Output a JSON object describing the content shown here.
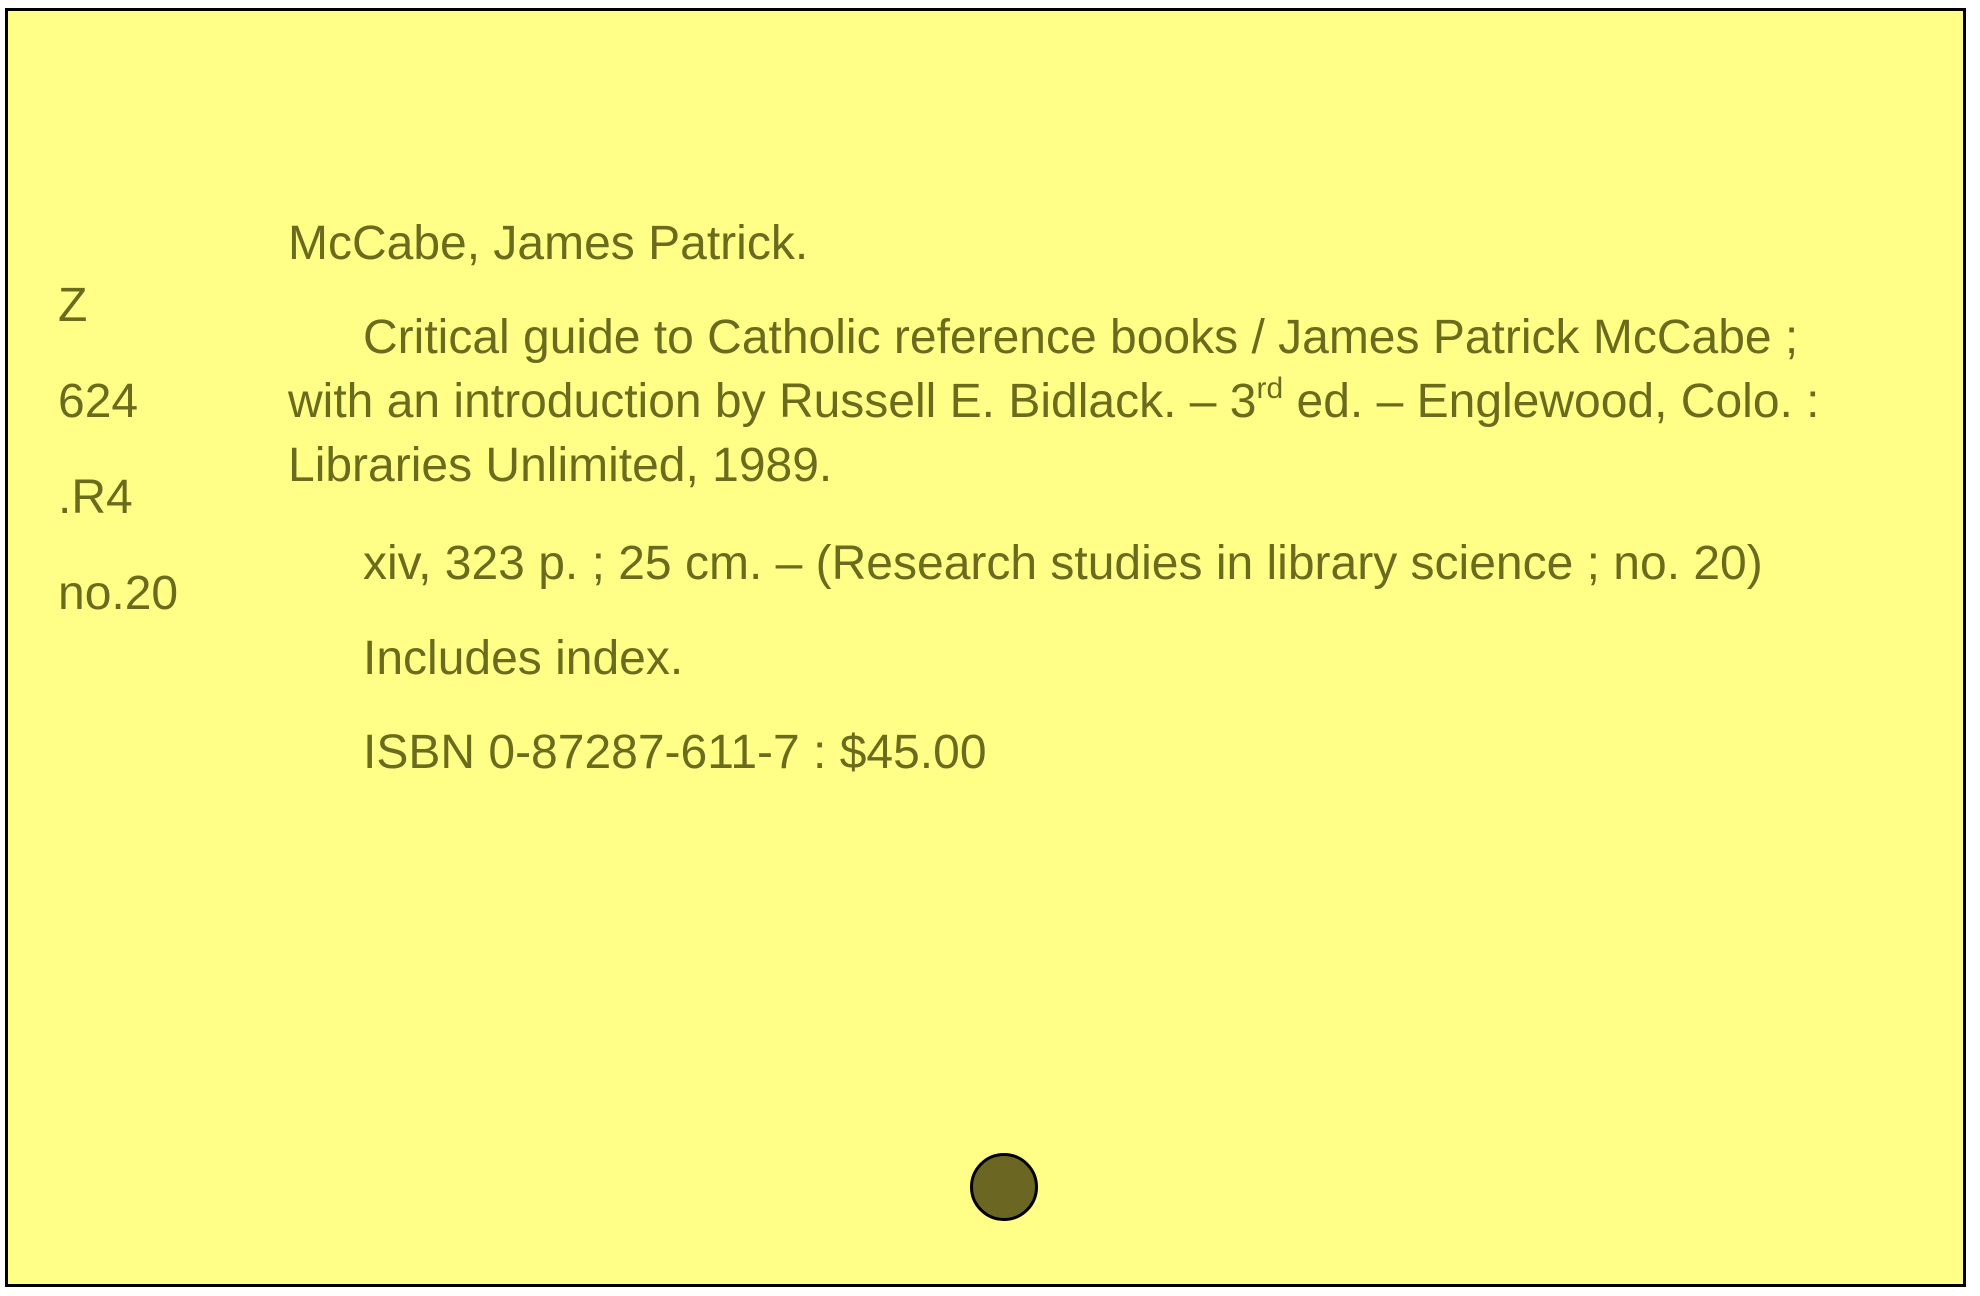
{
  "card": {
    "call_number": {
      "line1": "Z",
      "line2": "624",
      "line3": ".R4",
      "line4": "no.20"
    },
    "main_entry": "McCabe, James Patrick.",
    "title_statement": {
      "before_sup": "Critical guide to Catholic reference books / James Patrick McCabe ; with an introduction by Russell E. Bidlack. – 3",
      "sup": "rd",
      "after_sup": " ed. – Englewood, Colo. : Libraries Unlimited, 1989."
    },
    "collation": "xiv, 323 p. ; 25 cm. – (Research studies in library science ; no. 20)",
    "notes": "Includes index.",
    "isbn": "ISBN 0-87287-611-7 : $45.00"
  },
  "colors": {
    "card_background": "#ffff88",
    "text": "#6b6b1e",
    "punch_hole": "#6b6622",
    "border": "#000000"
  }
}
